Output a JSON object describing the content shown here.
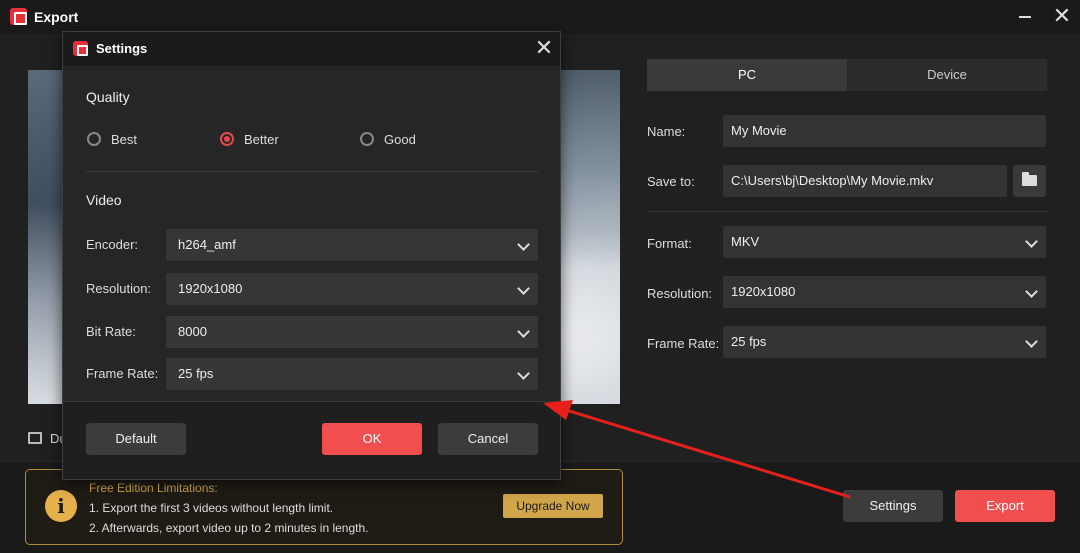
{
  "window": {
    "title": "Export"
  },
  "preview": {
    "duration_label": "Du"
  },
  "export_panel": {
    "tabs": [
      {
        "label": "PC"
      },
      {
        "label": "Device"
      }
    ],
    "name": {
      "label": "Name:",
      "value": "My Movie"
    },
    "save_to": {
      "label": "Save to:",
      "value": "C:\\Users\\bj\\Desktop\\My Movie.mkv"
    },
    "format": {
      "label": "Format:",
      "value": "MKV"
    },
    "resolution": {
      "label": "Resolution:",
      "value": "1920x1080"
    },
    "frame_rate": {
      "label": "Frame Rate:",
      "value": "25 fps"
    }
  },
  "limitations": {
    "title": "Free Edition Limitations:",
    "line1": "1. Export the first 3 videos without length limit.",
    "line2": "2. Afterwards, export video up to 2 minutes in length.",
    "upgrade_label": "Upgrade Now"
  },
  "actions": {
    "settings_label": "Settings",
    "export_label": "Export"
  },
  "settings_dialog": {
    "title": "Settings",
    "quality": {
      "title": "Quality",
      "options": [
        {
          "label": "Best"
        },
        {
          "label": "Better"
        },
        {
          "label": "Good"
        }
      ],
      "selected": "Better"
    },
    "video": {
      "title": "Video",
      "encoder": {
        "label": "Encoder:",
        "value": "h264_amf"
      },
      "resolution": {
        "label": "Resolution:",
        "value": "1920x1080"
      },
      "bit_rate": {
        "label": "Bit Rate:",
        "value": "8000"
      },
      "frame_rate": {
        "label": "Frame Rate:",
        "value": "25 fps"
      }
    },
    "buttons": {
      "default_label": "Default",
      "ok_label": "OK",
      "cancel_label": "Cancel"
    }
  },
  "colors": {
    "accent": "#f14f4f",
    "warning": "#d1a54a",
    "annotation_arrow": "#e8201c"
  },
  "icons": [
    "app-logo-icon",
    "minimize-icon",
    "close-icon",
    "folder-icon",
    "chevron-down-icon",
    "film-icon",
    "info-icon"
  ]
}
